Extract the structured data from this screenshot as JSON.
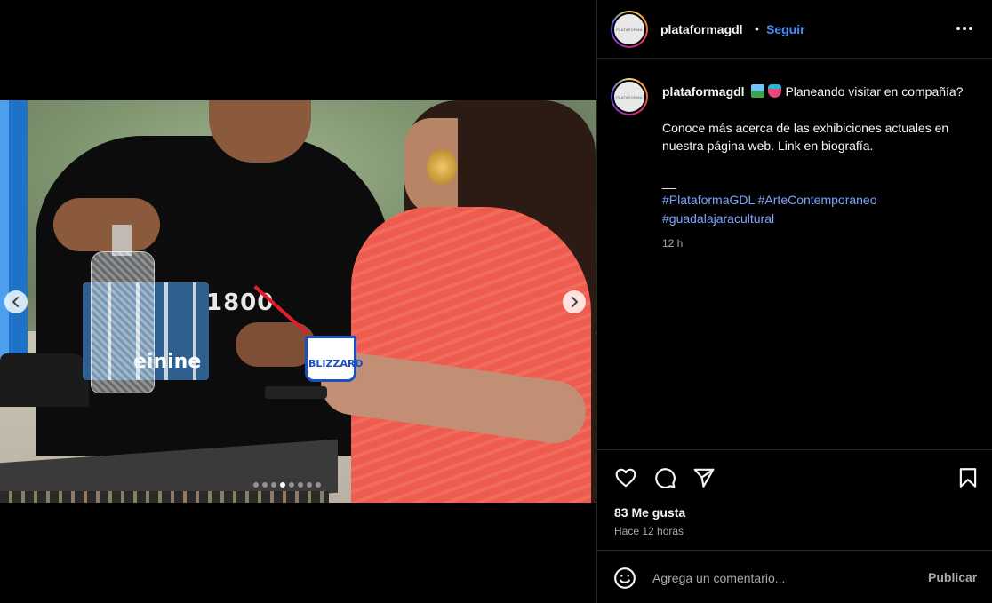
{
  "post": {
    "username": "plataformagdl",
    "separator": "•",
    "follow_label": "Seguir",
    "avatar_text": "PLATAFORMA",
    "caption": {
      "line1": "Planeando visitar en compañía?",
      "line2": "Conoce más acerca de las exhibiciones actuales en nuestra página web. Link en biografía.",
      "line3": "__",
      "hashtags": [
        "#PlataformaGDL",
        "#ArteContemporaneo",
        "#guadalajaracultural"
      ],
      "time": "12 h"
    },
    "likes": "83 Me gusta",
    "ago": "Hace 12 horas",
    "comment_placeholder": "Agrega un comentario...",
    "publish_label": "Publicar"
  },
  "media": {
    "bottle_brand": "1800",
    "cans_brand": "einine",
    "cup_brand": "BLIZZARD",
    "carousel": {
      "total": 8,
      "active": 3
    }
  },
  "icons": {
    "prev": "chevron-left-icon",
    "next": "chevron-right-icon",
    "more": "more-horizontal-icon",
    "like": "heart-icon",
    "comment": "comment-icon",
    "share": "send-icon",
    "save": "bookmark-icon",
    "emoji": "smiley-icon"
  },
  "colors": {
    "background": "#000000",
    "link": "#4a8cf7",
    "hashtag": "#7da3ff",
    "muted": "#a8a8a8",
    "divider": "#262626"
  }
}
